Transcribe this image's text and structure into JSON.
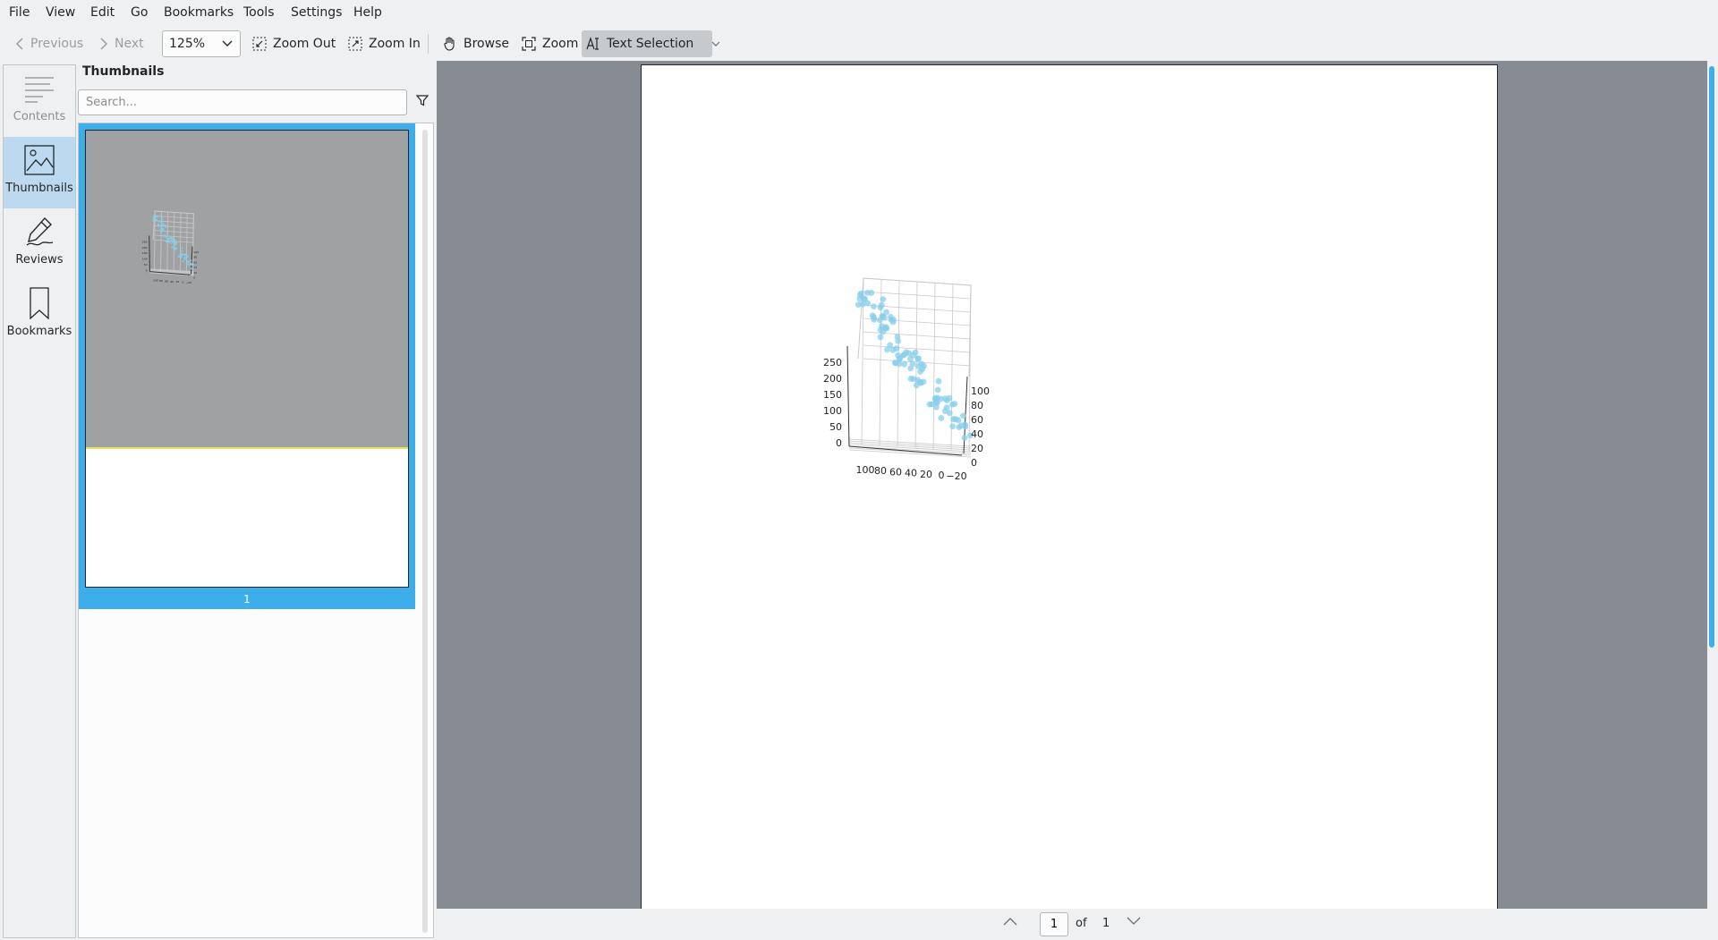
{
  "menu": [
    "File",
    "View",
    "Edit",
    "Go",
    "Bookmarks",
    "Tools",
    "Settings",
    "Help"
  ],
  "toolbar": {
    "previous": "Previous",
    "next": "Next",
    "zoom_value": "125%",
    "zoom_out": "Zoom Out",
    "zoom_in": "Zoom In",
    "browse": "Browse",
    "zoom": "Zoom",
    "text_selection": "Text Selection"
  },
  "sidebar": {
    "items": [
      {
        "label": "Contents",
        "icon": "contents-icon",
        "selected": false
      },
      {
        "label": "Thumbnails",
        "icon": "image-icon",
        "selected": true
      },
      {
        "label": "Reviews",
        "icon": "pen-icon",
        "selected": false
      },
      {
        "label": "Bookmarks",
        "icon": "bookmark-icon",
        "selected": false
      }
    ]
  },
  "thumbnails": {
    "title": "Thumbnails",
    "search_placeholder": "Search...",
    "page_number": "1"
  },
  "pager": {
    "current": "1",
    "of": "of",
    "total": "1"
  },
  "colors": {
    "accent": "#3daee9",
    "point": "#87ceeb",
    "viewport": "#878b92"
  },
  "chart_data": {
    "type": "scatter",
    "dimensions": 3,
    "z_ticks": [
      "0",
      "50",
      "100",
      "150",
      "200",
      "250"
    ],
    "x_ticks": [
      "100",
      "80",
      "60",
      "40",
      "20",
      "0",
      "−20"
    ],
    "y_ticks": [
      "0",
      "20",
      "40",
      "60",
      "80",
      "100"
    ],
    "color": "#87ceeb",
    "grid": true,
    "points_approx": 100
  }
}
